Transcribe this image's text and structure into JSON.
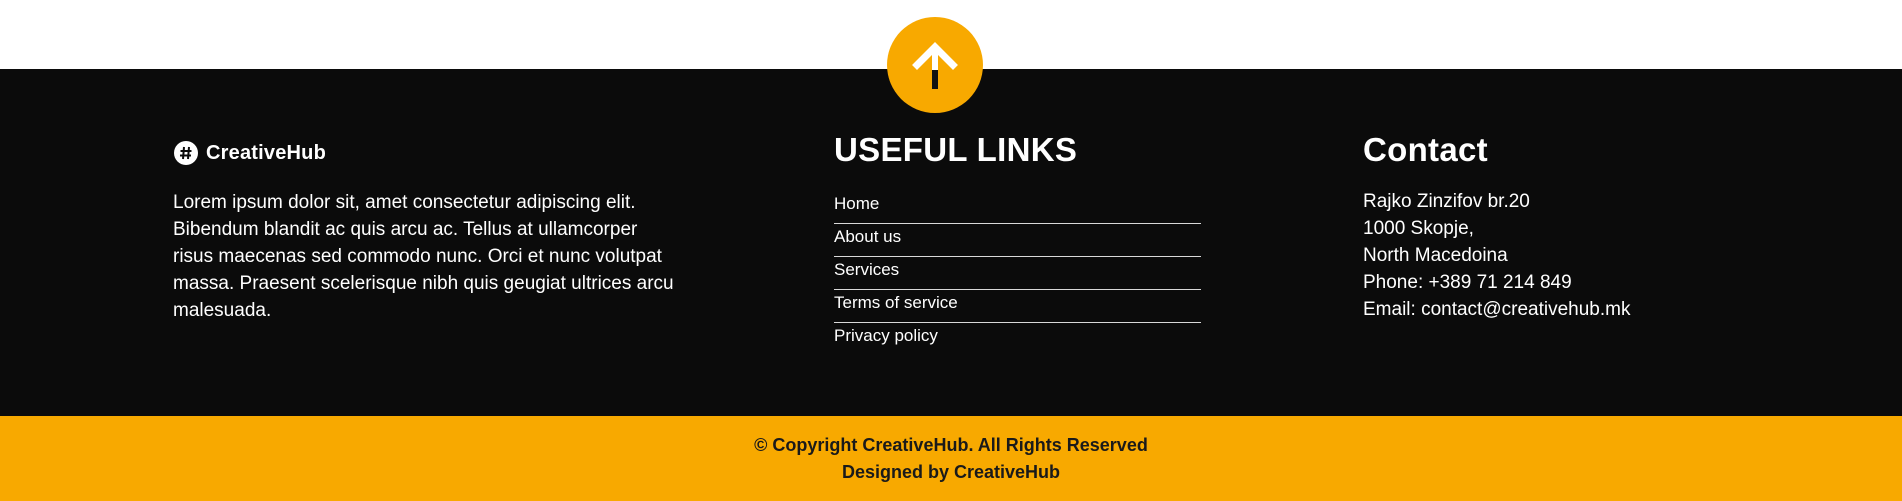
{
  "brand": {
    "name": "CreativeHub",
    "logo_icon": "hashtag-circle-icon",
    "about": "Lorem ipsum dolor sit, amet consectetur adipiscing elit. Bibendum blandit ac quis arcu ac. Tellus at ullamcorper risus maecenas sed commodo nunc. Orci et nunc volutpat massa. Praesent scelerisque nibh quis geugiat ultrices arcu malesuada."
  },
  "back_to_top": {
    "icon": "arrow-up-icon"
  },
  "useful_links": {
    "title": "USEFUL LINKS",
    "items": [
      {
        "label": "Home"
      },
      {
        "label": "About us"
      },
      {
        "label": "Services"
      },
      {
        "label": "Terms of service"
      },
      {
        "label": "Privacy policy"
      }
    ]
  },
  "contact": {
    "title": "Contact",
    "address_line1": "Rajko Zinzifov br.20",
    "address_line2": "1000 Skopje,",
    "address_line3": "North Macedoina",
    "phone": "Phone: +389 71 214 849",
    "email": "Email: contact@creativehub.mk"
  },
  "bottom_bar": {
    "copyright": "© Copyright CreativeHub. All Rights Reserved",
    "designed_by": "Designed by CreativeHub"
  },
  "colors": {
    "accent": "#f8a900",
    "footer_bg": "#0b0b0b",
    "text_light": "#ffffff",
    "text_dark": "#1a1a1a"
  }
}
